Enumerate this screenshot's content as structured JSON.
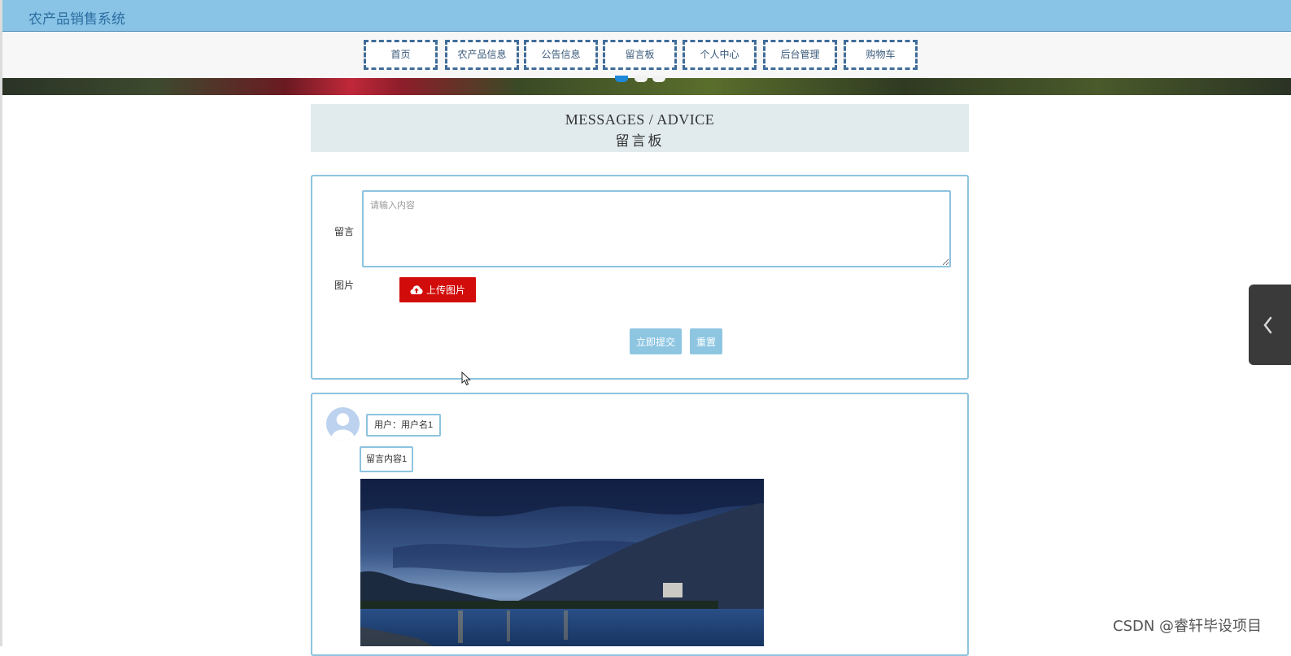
{
  "app": {
    "title": "农产品销售系统"
  },
  "nav": {
    "items": [
      {
        "label": "首页"
      },
      {
        "label": "农产品信息"
      },
      {
        "label": "公告信息"
      },
      {
        "label": "留言板"
      },
      {
        "label": "个人中心"
      },
      {
        "label": "后台管理"
      },
      {
        "label": "购物车"
      }
    ]
  },
  "banner": {
    "slide_count": 3,
    "active_slide": 1
  },
  "page_heading": {
    "en": "MESSAGES / ADVICE",
    "cn": "留言板"
  },
  "form": {
    "message_label": "留言",
    "message_placeholder": "请输入内容",
    "image_label": "图片",
    "upload_label": "上传图片",
    "submit_label": "立即提交",
    "reset_label": "重置"
  },
  "messages": [
    {
      "user": "用户：用户名1",
      "content": "留言内容1"
    }
  ],
  "watermark": "CSDN @睿轩毕设项目",
  "icons": {
    "upload": "cloud-upload-icon",
    "avatar": "user-avatar-icon",
    "side_tab": "chevron-left-icon",
    "cursor": "mouse-cursor-icon"
  },
  "colors": {
    "topbar": "#89c4e6",
    "nav_border": "#3f6c99",
    "card_border": "#8ec3df",
    "upload_button": "#d20b0b",
    "action_button": "#8ec6e2",
    "heading_bg": "#e1ebee"
  }
}
